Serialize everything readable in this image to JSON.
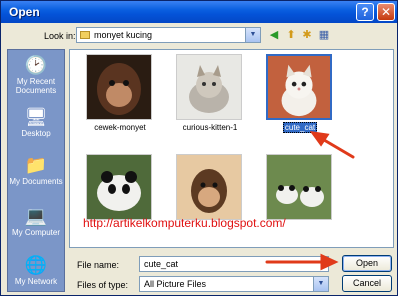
{
  "window": {
    "title": "Open",
    "help_label": "?",
    "close_label": "✕"
  },
  "toolbar": {
    "look_in_label": "Look in:",
    "look_in_value": "monyet kucing",
    "icons": [
      "back-icon",
      "up-folder-icon",
      "new-folder-icon",
      "views-icon"
    ]
  },
  "places": [
    {
      "label": "My Recent Documents",
      "icon": "recent-documents-icon"
    },
    {
      "label": "Desktop",
      "icon": "desktop-icon"
    },
    {
      "label": "My Documents",
      "icon": "my-documents-icon"
    },
    {
      "label": "My Computer",
      "icon": "my-computer-icon"
    },
    {
      "label": "My Network",
      "icon": "my-network-icon"
    }
  ],
  "files": [
    {
      "name": "cewek-monyet",
      "selected": false
    },
    {
      "name": "curious-kitten-1",
      "selected": false
    },
    {
      "name": "cute_cat",
      "selected": true
    },
    {
      "name": "",
      "selected": false
    },
    {
      "name": "",
      "selected": false
    },
    {
      "name": "",
      "selected": false
    }
  ],
  "watermark": "http://artikelkomputerku.blogspot.com/",
  "bottom": {
    "file_name_label": "File name:",
    "file_name_value": "cute_cat",
    "file_type_label": "Files of type:",
    "file_type_value": "All Picture Files",
    "open_label": "Open",
    "cancel_label": "Cancel"
  },
  "colors": {
    "titlebar": "#0453d8",
    "selection": "#316ac5",
    "annotation": "#e03a1a",
    "places_bg": "#7b96c8"
  }
}
